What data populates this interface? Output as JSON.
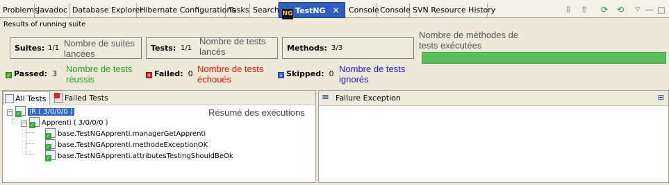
{
  "tabs": [
    {
      "label": "Problems"
    },
    {
      "label": "Javadoc"
    },
    {
      "label": "Database Explorer"
    },
    {
      "label": "Hibernate Configurations"
    },
    {
      "label": "Tasks"
    },
    {
      "label": "Search"
    },
    {
      "label": "TestNG",
      "active": true
    },
    {
      "label": "Console"
    },
    {
      "label": "Console"
    },
    {
      "label": "SVN Resource History"
    }
  ],
  "toolbar_icons": [
    "arrow-down-icon",
    "arrow-up-icon",
    "rerun-icon",
    "rerun-failed-icon",
    "view-menu-icon",
    "minimize-icon",
    "maximize-icon"
  ],
  "header": {
    "title": "Results of running suite"
  },
  "summary": {
    "suites": {
      "label": "Suites:",
      "value": "1/1",
      "note": "Nombre de suites lancées"
    },
    "tests": {
      "label": "Tests:",
      "value": "1/1",
      "note": "Nombre de tests lancés"
    },
    "methods": {
      "label": "Methods:",
      "value": "3/3",
      "note": "Nombre de méthodes de tests exécutées"
    },
    "progress": {
      "fraction": 1.0,
      "color": "#5cbd5c"
    }
  },
  "stats": {
    "passed": {
      "label": "Passed:",
      "value": "3",
      "note": "Nombre de tests réussis",
      "color": "#1fa21f"
    },
    "failed": {
      "label": "Failed:",
      "value": "0",
      "note": "Nombre de tests échoués",
      "color": "#ee1111"
    },
    "skipped": {
      "label": "Skipped:",
      "value": "0",
      "note": "Nombre de tests ignorés",
      "color": "#1a1acc"
    }
  },
  "left_tabs": {
    "all_tests": "All Tests",
    "failed_tests": "Failed Tests"
  },
  "tree": {
    "annotation": "Résumé des exécutions",
    "suite": "IR ( 3/0/0/0 )",
    "test": "Apprenti ( 3/0/0/0 )",
    "methods": [
      "base.TestNGApprenti.managerGetApprenti",
      "base.TestNGApprenti.methodeExceptionOK",
      "base.TestNGApprenti.attributesTestingShouldBeOk"
    ]
  },
  "right_panel": {
    "title": "Failure Exception"
  }
}
